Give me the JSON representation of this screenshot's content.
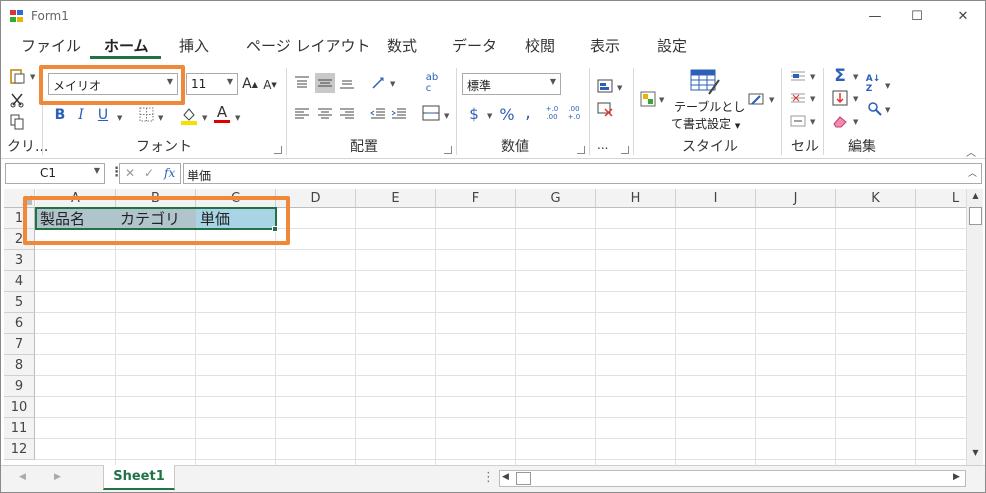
{
  "window": {
    "title": "Form1",
    "minimize": "—",
    "maximize": "☐",
    "close": "✕"
  },
  "tabs": [
    "ファイル",
    "ホーム",
    "挿入",
    "ページ レイアウト",
    "数式",
    "データ",
    "校閲",
    "表示",
    "設定"
  ],
  "active_tab": "ホーム",
  "ribbon": {
    "clipboard": {
      "label": "クリ..."
    },
    "font": {
      "label": "フォント",
      "font_name": "メイリオ",
      "font_size": "11",
      "grow": "A",
      "shrink": "A",
      "bold": "B",
      "italic": "I",
      "underline": "U",
      "font_color_letter": "A",
      "fill_color": "#f5e100",
      "font_color": "#e00000"
    },
    "alignment": {
      "label": "配置"
    },
    "number": {
      "label": "数値",
      "format": "標準",
      "currency": "$",
      "percent": "%",
      "comma": ",",
      "inc_decimal": "+.0 .00",
      "dec_decimal": ".00 +.0"
    },
    "more": {
      "label": "..."
    },
    "styles": {
      "label": "スタイル",
      "table_format": "テーブルとし",
      "table_format2": "て書式設定"
    },
    "cells": {
      "label": "セル"
    },
    "editing": {
      "label": "編集",
      "sum": "Σ"
    }
  },
  "formula_bar": {
    "name_box": "C1",
    "cancel": "✕",
    "enter": "✓",
    "fx": "fx",
    "value": "単価"
  },
  "columns": [
    "A",
    "B",
    "C",
    "D",
    "E",
    "F",
    "G",
    "H",
    "I",
    "J",
    "K",
    "L"
  ],
  "rows": [
    "1",
    "2",
    "3",
    "4",
    "5",
    "6",
    "7",
    "8",
    "9",
    "10",
    "11",
    "12"
  ],
  "cells": {
    "A1": "製品名",
    "B1": "カテゴリ",
    "C1": "単価"
  },
  "sheet_tab": "Sheet1",
  "colors": {
    "accent": "#217346",
    "highlight": "#f0883a",
    "selection": "#a8d4e6"
  }
}
